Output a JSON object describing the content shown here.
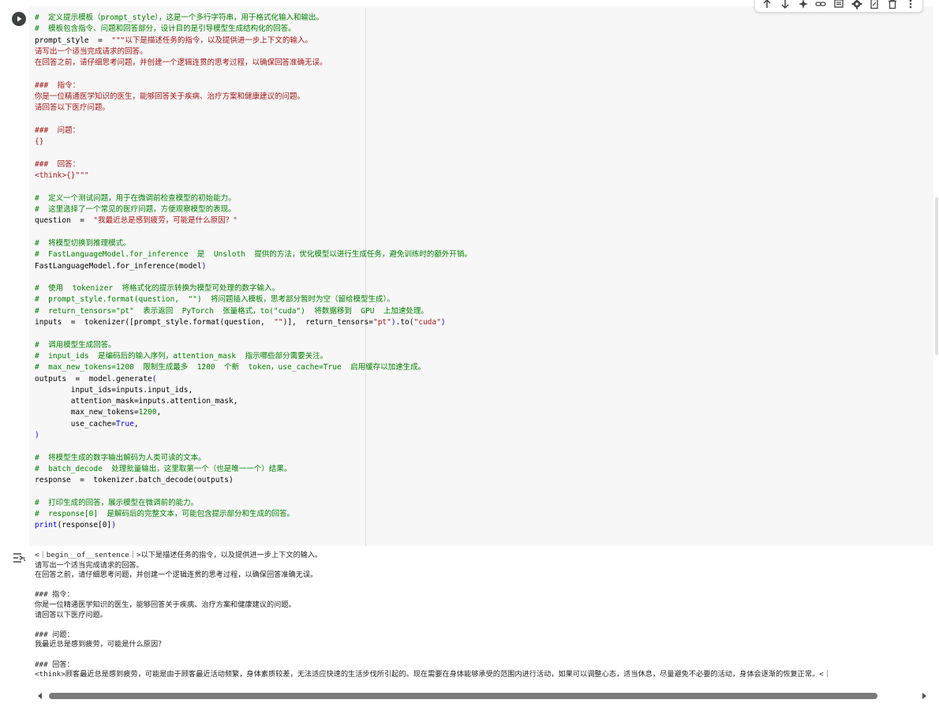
{
  "toolbar": {
    "icons": [
      "arrow-up-icon",
      "arrow-down-icon",
      "sparkle-icon",
      "link-icon",
      "comment-icon",
      "gear-icon",
      "mirror-cell-icon",
      "delete-icon",
      "more-vert-icon"
    ]
  },
  "code_lines": [
    [
      {
        "t": "c",
        "v": "#  定义提示模板（prompt_style），这是一个多行字符串，用于格式化输入和输出。"
      }
    ],
    [
      {
        "t": "c",
        "v": "#  模板包含指令、问题和回答部分，设计目的是引导模型生成结构化的回答。"
      }
    ],
    [
      {
        "t": "p",
        "v": "prompt_style  =  "
      },
      {
        "t": "s",
        "v": "\"\"\"以下是描述任务的指令，以及提供进一步上下文的输入。"
      }
    ],
    [
      {
        "t": "s",
        "v": "请写出一个适当完成请求的回答。"
      }
    ],
    [
      {
        "t": "s",
        "v": "在回答之前，请仔细思考问题，并创建一个逻辑连贯的思考过程，以确保回答准确无误。"
      }
    ],
    [],
    [
      {
        "t": "s",
        "v": "###  指令："
      }
    ],
    [
      {
        "t": "s",
        "v": "你是一位精通医学知识的医生，能够回答关于疾病、治疗方案和健康建议的问题。"
      }
    ],
    [
      {
        "t": "s",
        "v": "请回答以下医疗问题。"
      }
    ],
    [],
    [
      {
        "t": "s",
        "v": "###  问题："
      }
    ],
    [
      {
        "t": "s",
        "v": "{}"
      }
    ],
    [],
    [
      {
        "t": "s",
        "v": "###  回答："
      }
    ],
    [
      {
        "t": "s",
        "v": "<think>{}\"\"\""
      }
    ],
    [],
    [
      {
        "t": "c",
        "v": "#  定义一个测试问题，用于在微调前检查模型的初始能力。"
      }
    ],
    [
      {
        "t": "c",
        "v": "#  这里选择了一个常见的医疗问题，方便观察模型的表现。"
      }
    ],
    [
      {
        "t": "p",
        "v": "question  =  "
      },
      {
        "t": "s",
        "v": "\"我最近总是感到疲劳，可能是什么原因？\""
      }
    ],
    [],
    [
      {
        "t": "c",
        "v": "#  将模型切换到推理模式。"
      }
    ],
    [
      {
        "t": "c",
        "v": "#  FastLanguageModel.for_inference  是  Unsloth  提供的方法，优化模型以进行生成任务，避免训练时的额外开销。"
      }
    ],
    [
      {
        "t": "p",
        "v": "FastLanguageModel.for_inference(model"
      },
      {
        "t": "k",
        "v": ")"
      }
    ],
    [],
    [
      {
        "t": "c",
        "v": "#  使用  tokenizer  将格式化的提示转换为模型可处理的数字输入。"
      }
    ],
    [
      {
        "t": "c",
        "v": "#  prompt_style.format(question,  \"\")  将问题插入模板，思考部分暂时为空（留给模型生成）。"
      }
    ],
    [
      {
        "t": "c",
        "v": "#  return_tensors=\"pt\"  表示返回  PyTorch  张量格式，to(\"cuda\")  将数据移到  GPU  上加速处理。"
      }
    ],
    [
      {
        "t": "p",
        "v": "inputs  =  tokenizer([prompt_style.format(question,  "
      },
      {
        "t": "s",
        "v": "\"\""
      },
      {
        "t": "p",
        "v": ")],  return_tensors="
      },
      {
        "t": "s",
        "v": "\"pt\""
      },
      {
        "t": "k",
        "v": ")"
      },
      {
        "t": "p",
        "v": ".to("
      },
      {
        "t": "s",
        "v": "\"cuda\""
      },
      {
        "t": "k",
        "v": ")"
      }
    ],
    [],
    [
      {
        "t": "c",
        "v": "#  调用模型生成回答。"
      }
    ],
    [
      {
        "t": "c",
        "v": "#  input_ids  是编码后的输入序列，attention_mask  指示哪些部分需要关注。"
      }
    ],
    [
      {
        "t": "c",
        "v": "#  max_new_tokens=1200  限制生成最多  1200  个新  token，use_cache=True  启用缓存以加速生成。"
      }
    ],
    [
      {
        "t": "p",
        "v": "outputs  =  model.generate"
      },
      {
        "t": "k",
        "v": "("
      }
    ],
    [
      {
        "t": "p",
        "v": "        input_ids=inputs.input_ids,"
      }
    ],
    [
      {
        "t": "p",
        "v": "        attention_mask=inputs.attention_mask,"
      }
    ],
    [
      {
        "t": "p",
        "v": "        max_new_tokens="
      },
      {
        "t": "c",
        "v": "1200"
      },
      {
        "t": "p",
        "v": ","
      }
    ],
    [
      {
        "t": "p",
        "v": "        use_cache="
      },
      {
        "t": "k",
        "v": "True"
      },
      {
        "t": "p",
        "v": ","
      }
    ],
    [
      {
        "t": "k",
        "v": ")"
      }
    ],
    [],
    [
      {
        "t": "c",
        "v": "#  将模型生成的数字输出解码为人类可读的文本。"
      }
    ],
    [
      {
        "t": "c",
        "v": "#  batch_decode  处理批量输出，这里取第一个（也是唯一一个）结果。"
      }
    ],
    [
      {
        "t": "p",
        "v": "response  =  tokenizer.batch_decode(outputs)"
      }
    ],
    [],
    [
      {
        "t": "c",
        "v": "#  打印生成的回答，展示模型在微调前的能力。"
      }
    ],
    [
      {
        "t": "c",
        "v": "#  response[0]  是解码后的完整文本，可能包含提示部分和生成的回答。"
      }
    ],
    [
      {
        "t": "k",
        "v": "print"
      },
      {
        "t": "p",
        "v": "(response[0]"
      },
      {
        "t": "k",
        "v": ")"
      }
    ]
  ],
  "output_lines": [
    "<｜begin__of__sentence｜>以下是描述任务的指令，以及提供进一步上下文的输入。",
    "请写出一个适当完成请求的回答。",
    "在回答之前，请仔细思考问题，并创建一个逻辑连贯的思考过程，以确保回答准确无误。",
    "",
    "### 指令：",
    "你是一位精通医学知识的医生，能够回答关于疾病、治疗方案和健康建议的问题。",
    "请回答以下医疗问题。",
    "",
    "### 问题：",
    "我最近总是感到疲劳，可能是什么原因？",
    "",
    "### 回答：",
    "<think>顾客最近总是感到疲劳，可能是由于顾客最近活动频繁，身体素质较差，无法适应快速的生活步伐所引起的。现在需要在身体能够承受的范围内进行活动，如果可以调整心态，适当休息，尽量避免不必要的活动，身体会逐渐的恢复正常。<｜"
  ],
  "colors": {
    "comment": "#008000",
    "string": "#a31515",
    "keyword": "#0000ff",
    "editor_bg": "#f7f7f7"
  }
}
